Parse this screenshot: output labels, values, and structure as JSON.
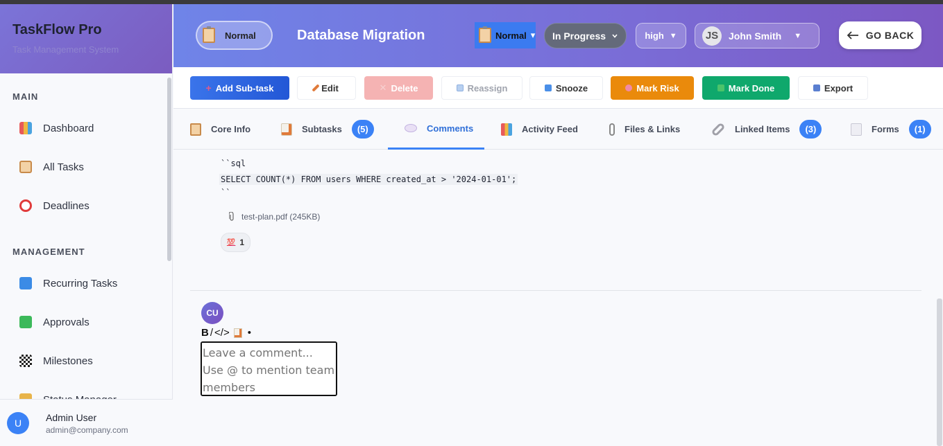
{
  "app": {
    "title": "TaskFlow Pro",
    "subtitle": "Task Management System"
  },
  "sidebar": {
    "sections": [
      {
        "title": "MAIN",
        "items": [
          {
            "label": "Dashboard",
            "icon": "bar-chart-icon"
          },
          {
            "label": "All Tasks",
            "icon": "clipboard-icon"
          },
          {
            "label": "Deadlines",
            "icon": "alarm-clock-icon"
          }
        ]
      },
      {
        "title": "MANAGEMENT",
        "items": [
          {
            "label": "Recurring Tasks",
            "icon": "repeat-icon"
          },
          {
            "label": "Approvals",
            "icon": "check-box-icon"
          },
          {
            "label": "Milestones",
            "icon": "checkered-flag-icon"
          },
          {
            "label": "Status Manager",
            "icon": "tag-icon"
          }
        ]
      }
    ],
    "user": {
      "initial": "U",
      "name": "Admin User",
      "email": "admin@company.com"
    }
  },
  "header": {
    "type_chip": "Normal",
    "task_title": "Database Migration",
    "type_select": "Normal",
    "type_select_arrow": "▾",
    "status": "In Progress",
    "priority": "high",
    "priority_arrow": "▼",
    "assignee": {
      "initials": "JS",
      "name": "John Smith",
      "arrow": "▼"
    },
    "go_back": "GO BACK"
  },
  "toolbar": {
    "buttons": [
      {
        "label": "Add Sub-task",
        "icon": "plus-icon"
      },
      {
        "label": "Edit",
        "icon": "pencil-icon"
      },
      {
        "label": "Delete",
        "icon": "x-icon"
      },
      {
        "label": "Reassign",
        "icon": "reassign-icon"
      },
      {
        "label": "Snooze",
        "icon": "pause-icon"
      },
      {
        "label": "Mark Risk",
        "icon": "brain-icon"
      },
      {
        "label": "Mark Done",
        "icon": "check-icon"
      },
      {
        "label": "Export",
        "icon": "outbox-icon"
      }
    ],
    "colors": {
      "primary": "#2f6fe0",
      "delete": "#f5b3b3",
      "risk": "#ea8a0b",
      "done": "#0fa86c"
    }
  },
  "tabs": [
    {
      "label": "Core Info",
      "icon": "clipboard-icon",
      "badge": ""
    },
    {
      "label": "Subtasks",
      "icon": "memo-icon",
      "badge": "(5)"
    },
    {
      "label": "Comments",
      "icon": "speech-bubble-icon",
      "badge": ""
    },
    {
      "label": "Activity Feed",
      "icon": "bar-chart-icon",
      "badge": ""
    },
    {
      "label": "Files & Links",
      "icon": "paperclip-icon",
      "badge": ""
    },
    {
      "label": "Linked Items",
      "icon": "link-icon",
      "badge": "(3)"
    },
    {
      "label": "Forms",
      "icon": "document-icon",
      "badge": "(1)"
    }
  ],
  "active_tab": "Comments",
  "comment": {
    "code_open": "``sql",
    "code_line": "SELECT COUNT(*) FROM users WHERE created_at > '2024-01-01';",
    "code_close": "``",
    "attachment": "test-plan.pdf (245KB)",
    "reaction_count": "1",
    "reaction_icon": "hundred-points-icon"
  },
  "composer": {
    "avatar": "CU",
    "format_bold": "B",
    "format_italic": "/",
    "format_code": "</>",
    "format_bullet": "•",
    "placeholder": "Leave a comment... Use @ to mention team members"
  }
}
